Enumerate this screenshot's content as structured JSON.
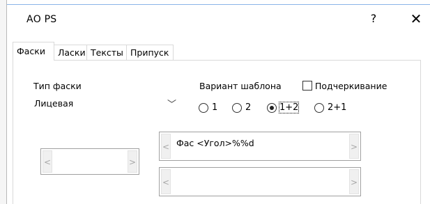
{
  "window": {
    "title": "АО PS",
    "help_label": "?",
    "close_label": "✕"
  },
  "tabs": [
    {
      "label": "Фаски",
      "active": true
    },
    {
      "label": "Ласки",
      "active": false
    },
    {
      "label": "Тексты",
      "active": false
    },
    {
      "label": "Припуск",
      "active": false
    }
  ],
  "chamfer_type": {
    "label": "Тип фаски",
    "value": "Лицевая"
  },
  "template_variant": {
    "label": "Вариант шаблона",
    "options": [
      "1",
      "2",
      "1+2",
      "2+1"
    ],
    "selected": "1+2"
  },
  "underline": {
    "label": "Подчеркивание",
    "checked": false
  },
  "format_fields": {
    "small_spin_value": "",
    "top_field_value": "Фас <Угол>%%d",
    "bottom_field_value": "",
    "arrow_left": "<",
    "arrow_right": ">"
  }
}
